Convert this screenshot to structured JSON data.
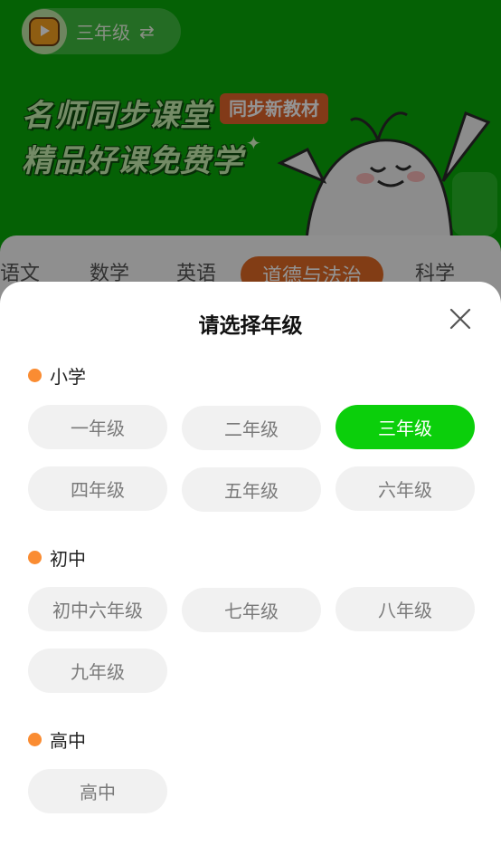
{
  "banner": {
    "current_grade": "三年级",
    "headline_line1": "名师同步课堂",
    "headline_line2": "精品好课免费学",
    "tag": "同步新教材"
  },
  "subject_tabs": [
    {
      "label": "语文"
    },
    {
      "label": "数学"
    },
    {
      "label": "英语"
    },
    {
      "label": "道德与法治",
      "active": true
    },
    {
      "label": "科学"
    }
  ],
  "sheet": {
    "title": "请选择年级",
    "sections": [
      {
        "label": "小学",
        "grades": [
          "一年级",
          "二年级",
          "三年级",
          "四年级",
          "五年级",
          "六年级"
        ]
      },
      {
        "label": "初中",
        "grades": [
          "初中六年级",
          "七年级",
          "八年级",
          "九年级"
        ]
      },
      {
        "label": "高中",
        "grades": [
          "高中"
        ]
      }
    ],
    "selected_grade": "三年级"
  },
  "colors": {
    "banner_green": "#0aa80a",
    "selected_green": "#0bcf0b",
    "dot_orange": "#fa8c32",
    "tab_active_orange": "#e06a25"
  }
}
